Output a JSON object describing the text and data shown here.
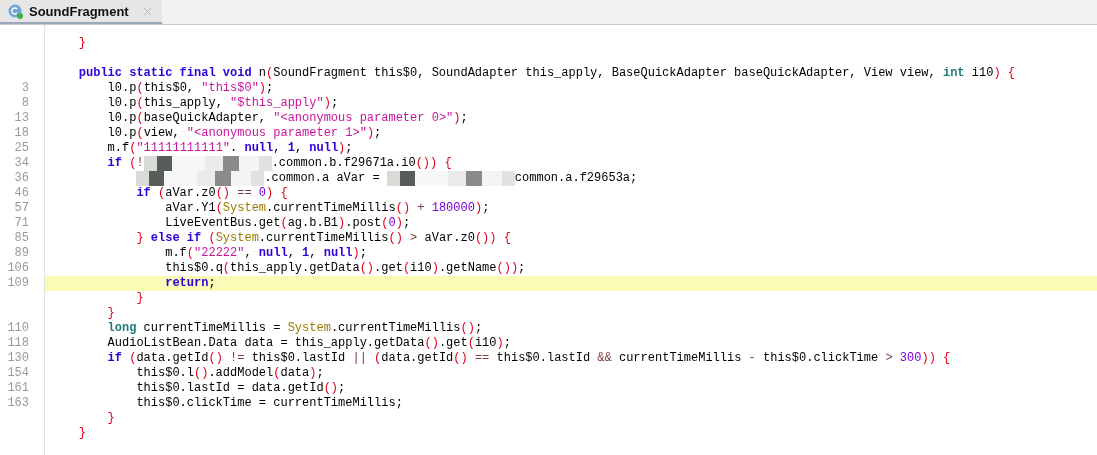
{
  "tab": {
    "title": "SoundFragment",
    "selected": true
  },
  "lines": [
    {
      "kind": "code",
      "tokens": [
        {
          "kind": "paren",
          "text": "}"
        }
      ]
    },
    {
      "kind": "blank"
    },
    {
      "kind": "code",
      "tokens": [
        {
          "kind": "keyword",
          "text": "public static final void"
        },
        {
          "kind": "plain",
          "text": " n"
        },
        {
          "kind": "paren",
          "text": "("
        },
        {
          "kind": "plain",
          "text": "SoundFragment this$0, SoundAdapter this_apply, BaseQuickAdapter baseQuickAdapter, View view, "
        },
        {
          "kind": "type",
          "text": "int"
        },
        {
          "kind": "plain",
          "text": " i10"
        },
        {
          "kind": "paren",
          "text": ") {"
        }
      ],
      "children": [
        {
          "kind": "code",
          "number": "3",
          "tokens": [
            {
              "kind": "plain",
              "text": "l0.p"
            },
            {
              "kind": "paren",
              "text": "("
            },
            {
              "kind": "plain",
              "text": "this$0, "
            },
            {
              "kind": "string",
              "text": "\"this$0\""
            },
            {
              "kind": "paren",
              "text": ")"
            },
            {
              "kind": "plain",
              "text": ";"
            }
          ]
        },
        {
          "kind": "code",
          "number": "8",
          "tokens": [
            {
              "kind": "plain",
              "text": "l0.p"
            },
            {
              "kind": "paren",
              "text": "("
            },
            {
              "kind": "plain",
              "text": "this_apply, "
            },
            {
              "kind": "string",
              "text": "\"$this_apply\""
            },
            {
              "kind": "paren",
              "text": ")"
            },
            {
              "kind": "plain",
              "text": ";"
            }
          ]
        },
        {
          "kind": "code",
          "number": "13",
          "tokens": [
            {
              "kind": "plain",
              "text": "l0.p"
            },
            {
              "kind": "paren",
              "text": "("
            },
            {
              "kind": "plain",
              "text": "baseQuickAdapter, "
            },
            {
              "kind": "string",
              "text": "\"<anonymous parameter 0>\""
            },
            {
              "kind": "paren",
              "text": ")"
            },
            {
              "kind": "plain",
              "text": ";"
            }
          ]
        },
        {
          "kind": "code",
          "number": "18",
          "tokens": [
            {
              "kind": "plain",
              "text": "l0.p"
            },
            {
              "kind": "paren",
              "text": "("
            },
            {
              "kind": "plain",
              "text": "view, "
            },
            {
              "kind": "string",
              "text": "\"<anonymous parameter 1>\""
            },
            {
              "kind": "paren",
              "text": ")"
            },
            {
              "kind": "plain",
              "text": ";"
            }
          ]
        },
        {
          "kind": "code",
          "number": "25",
          "tokens": [
            {
              "kind": "plain",
              "text": "m.f"
            },
            {
              "kind": "paren",
              "text": "("
            },
            {
              "kind": "string",
              "text": "\"11111111111\""
            },
            {
              "kind": "plain",
              "text": ". "
            },
            {
              "kind": "keyword",
              "text": "null"
            },
            {
              "kind": "plain",
              "text": ", "
            },
            {
              "kind": "keyword",
              "text": "1"
            },
            {
              "kind": "plain",
              "text": ", "
            },
            {
              "kind": "keyword",
              "text": "null"
            },
            {
              "kind": "paren",
              "text": ")"
            },
            {
              "kind": "plain",
              "text": ";"
            }
          ]
        },
        {
          "kind": "code",
          "number": "34",
          "tokens": [
            {
              "kind": "keyword",
              "text": "if"
            },
            {
              "kind": "paren",
              "text": " ("
            },
            {
              "kind": "operator",
              "text": "!"
            },
            {
              "kind": "redacted"
            },
            {
              "kind": "plain",
              "text": ".common.b.f29671a.i0"
            },
            {
              "kind": "paren",
              "text": "()) {"
            }
          ],
          "children": [
            {
              "kind": "code",
              "number": "36",
              "tokens": [
                {
                  "kind": "redacted"
                },
                {
                  "kind": "plain",
                  "text": ".common.a aVar = "
                },
                {
                  "kind": "redacted"
                },
                {
                  "kind": "plain",
                  "text": "common.a.f29653a;"
                }
              ]
            },
            {
              "kind": "code",
              "number": "46",
              "tokens": [
                {
                  "kind": "keyword",
                  "text": "if"
                },
                {
                  "kind": "paren",
                  "text": " ("
                },
                {
                  "kind": "plain",
                  "text": "aVar.z0"
                },
                {
                  "kind": "paren",
                  "text": "()"
                },
                {
                  "kind": "operator",
                  "text": " == "
                },
                {
                  "kind": "number",
                  "text": "0"
                },
                {
                  "kind": "paren",
                  "text": ") {"
                }
              ],
              "children": [
                {
                  "kind": "code",
                  "number": "57",
                  "tokens": [
                    {
                      "kind": "plain",
                      "text": "aVar.Y1"
                    },
                    {
                      "kind": "paren",
                      "text": "("
                    },
                    {
                      "kind": "class",
                      "text": "System"
                    },
                    {
                      "kind": "plain",
                      "text": ".currentTimeMillis"
                    },
                    {
                      "kind": "paren",
                      "text": "()"
                    },
                    {
                      "kind": "operator",
                      "text": " + "
                    },
                    {
                      "kind": "number",
                      "text": "180000"
                    },
                    {
                      "kind": "paren",
                      "text": ")"
                    },
                    {
                      "kind": "plain",
                      "text": ";"
                    }
                  ]
                },
                {
                  "kind": "code",
                  "number": "71",
                  "tokens": [
                    {
                      "kind": "plain",
                      "text": "LiveEventBus.get"
                    },
                    {
                      "kind": "paren",
                      "text": "("
                    },
                    {
                      "kind": "plain",
                      "text": "ag.b.B1"
                    },
                    {
                      "kind": "paren",
                      "text": ")"
                    },
                    {
                      "kind": "plain",
                      "text": ".post"
                    },
                    {
                      "kind": "paren",
                      "text": "("
                    },
                    {
                      "kind": "number",
                      "text": "0"
                    },
                    {
                      "kind": "paren",
                      "text": ")"
                    },
                    {
                      "kind": "plain",
                      "text": ";"
                    }
                  ]
                }
              ]
            },
            {
              "kind": "code",
              "number": "85",
              "tokens": [
                {
                  "kind": "paren",
                  "text": "}"
                },
                {
                  "kind": "keyword",
                  "text": " else if"
                },
                {
                  "kind": "paren",
                  "text": " ("
                },
                {
                  "kind": "class",
                  "text": "System"
                },
                {
                  "kind": "plain",
                  "text": ".currentTimeMillis"
                },
                {
                  "kind": "paren",
                  "text": "()"
                },
                {
                  "kind": "operator",
                  "text": " > "
                },
                {
                  "kind": "plain",
                  "text": "aVar.z0"
                },
                {
                  "kind": "paren",
                  "text": "()) {"
                }
              ],
              "children": [
                {
                  "kind": "code",
                  "number": "89",
                  "tokens": [
                    {
                      "kind": "plain",
                      "text": "m.f"
                    },
                    {
                      "kind": "paren",
                      "text": "("
                    },
                    {
                      "kind": "string",
                      "text": "\"22222\""
                    },
                    {
                      "kind": "plain",
                      "text": ", "
                    },
                    {
                      "kind": "keyword",
                      "text": "null"
                    },
                    {
                      "kind": "plain",
                      "text": ", "
                    },
                    {
                      "kind": "keyword",
                      "text": "1"
                    },
                    {
                      "kind": "plain",
                      "text": ", "
                    },
                    {
                      "kind": "keyword",
                      "text": "null"
                    },
                    {
                      "kind": "paren",
                      "text": ")"
                    },
                    {
                      "kind": "plain",
                      "text": ";"
                    }
                  ]
                },
                {
                  "kind": "code",
                  "number": "106",
                  "tokens": [
                    {
                      "kind": "plain",
                      "text": "this$0.q"
                    },
                    {
                      "kind": "paren",
                      "text": "("
                    },
                    {
                      "kind": "plain",
                      "text": "this_apply.getData"
                    },
                    {
                      "kind": "paren",
                      "text": "()"
                    },
                    {
                      "kind": "plain",
                      "text": ".get"
                    },
                    {
                      "kind": "paren",
                      "text": "("
                    },
                    {
                      "kind": "plain",
                      "text": "i10"
                    },
                    {
                      "kind": "paren",
                      "text": ")"
                    },
                    {
                      "kind": "plain",
                      "text": ".getName"
                    },
                    {
                      "kind": "paren",
                      "text": "())"
                    },
                    {
                      "kind": "plain",
                      "text": ";"
                    }
                  ]
                },
                {
                  "kind": "code",
                  "number": "109",
                  "highlighted": true,
                  "tokens": [
                    {
                      "kind": "keyword",
                      "text": "return"
                    },
                    {
                      "kind": "plain",
                      "text": ";"
                    }
                  ]
                }
              ]
            },
            {
              "kind": "code",
              "tokens": [
                {
                  "kind": "paren",
                  "text": "}"
                }
              ]
            }
          ]
        },
        {
          "kind": "code",
          "tokens": [
            {
              "kind": "paren",
              "text": "}"
            }
          ]
        },
        {
          "kind": "code",
          "number": "110",
          "tokens": [
            {
              "kind": "type",
              "text": "long"
            },
            {
              "kind": "plain",
              "text": " currentTimeMillis = "
            },
            {
              "kind": "class",
              "text": "System"
            },
            {
              "kind": "plain",
              "text": ".currentTimeMillis"
            },
            {
              "kind": "paren",
              "text": "()"
            },
            {
              "kind": "plain",
              "text": ";"
            }
          ]
        },
        {
          "kind": "code",
          "number": "118",
          "tokens": [
            {
              "kind": "plain",
              "text": "AudioListBean.Data data = this_apply.getData"
            },
            {
              "kind": "paren",
              "text": "()"
            },
            {
              "kind": "plain",
              "text": ".get"
            },
            {
              "kind": "paren",
              "text": "("
            },
            {
              "kind": "plain",
              "text": "i10"
            },
            {
              "kind": "paren",
              "text": ")"
            },
            {
              "kind": "plain",
              "text": ";"
            }
          ]
        },
        {
          "kind": "code",
          "number": "130",
          "tokens": [
            {
              "kind": "keyword",
              "text": "if"
            },
            {
              "kind": "paren",
              "text": " ("
            },
            {
              "kind": "plain",
              "text": "data.getId"
            },
            {
              "kind": "paren",
              "text": "()"
            },
            {
              "kind": "operator",
              "text": " != "
            },
            {
              "kind": "plain",
              "text": "this$0.lastId "
            },
            {
              "kind": "operator",
              "text": "||"
            },
            {
              "kind": "paren",
              "text": " ("
            },
            {
              "kind": "plain",
              "text": "data.getId"
            },
            {
              "kind": "paren",
              "text": "()"
            },
            {
              "kind": "operator",
              "text": " == "
            },
            {
              "kind": "plain",
              "text": "this$0.lastId "
            },
            {
              "kind": "operator",
              "text": "&&"
            },
            {
              "kind": "plain",
              "text": " currentTimeMillis "
            },
            {
              "kind": "operator",
              "text": "-"
            },
            {
              "kind": "plain",
              "text": " this$0.clickTime "
            },
            {
              "kind": "operator",
              "text": ">"
            },
            {
              "kind": "number",
              "text": " 300"
            },
            {
              "kind": "paren",
              "text": ")) {"
            }
          ],
          "children": [
            {
              "kind": "code",
              "number": "154",
              "tokens": [
                {
                  "kind": "plain",
                  "text": "this$0.l"
                },
                {
                  "kind": "paren",
                  "text": "()"
                },
                {
                  "kind": "plain",
                  "text": ".addModel"
                },
                {
                  "kind": "paren",
                  "text": "("
                },
                {
                  "kind": "plain",
                  "text": "data"
                },
                {
                  "kind": "paren",
                  "text": ")"
                },
                {
                  "kind": "plain",
                  "text": ";"
                }
              ]
            },
            {
              "kind": "code",
              "number": "161",
              "tokens": [
                {
                  "kind": "plain",
                  "text": "this$0.lastId = data.getId"
                },
                {
                  "kind": "paren",
                  "text": "()"
                },
                {
                  "kind": "plain",
                  "text": ";"
                }
              ]
            },
            {
              "kind": "code",
              "number": "163",
              "tokens": [
                {
                  "kind": "plain",
                  "text": "this$0.clickTime = currentTimeMillis;"
                }
              ]
            }
          ]
        },
        {
          "kind": "code",
          "tokens": [
            {
              "kind": "paren",
              "text": "}"
            }
          ]
        }
      ]
    },
    {
      "kind": "code",
      "tokens": [
        {
          "kind": "paren",
          "text": "}"
        }
      ]
    }
  ]
}
